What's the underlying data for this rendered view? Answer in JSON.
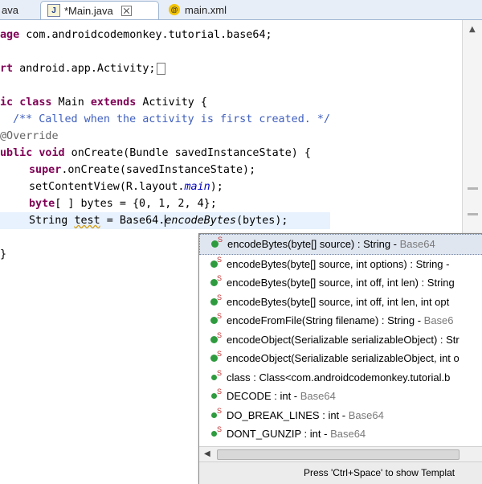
{
  "tabs": [
    {
      "label": "ava",
      "active": false
    },
    {
      "label": "*Main.java",
      "active": true
    },
    {
      "label": "main.xml",
      "active": false
    }
  ],
  "code": {
    "line1": [
      {
        "t": "age com.androidcodemonkey.tutorial.base64;",
        "c": "kw-partial"
      }
    ],
    "l1_kw": "age",
    "l1_rest": " com.androidcodemonkey.tutorial.base64;",
    "l3_kw": "rt",
    "l3_rest": " android.app.Activity;",
    "l5_kw1": "ic",
    "l5_kw2": "class",
    "l5_mid": " Main ",
    "l5_kw3": "extends",
    "l5_rest": " Activity {",
    "l6_comment": "/** Called when the activity is first created. */",
    "l7_anno": "@Override",
    "l8_kw1": "ublic",
    "l8_kw2": "void",
    "l8_rest": " onCreate(Bundle savedInstanceState) {",
    "l9_kw": "super",
    "l9_rest": ".onCreate(savedInstanceState);",
    "l10_pre": "setContentView(R.layout.",
    "l10_field": "main",
    "l10_post": ");",
    "l11_kw": "byte",
    "l11_rest": "[ ] bytes = {0, 1, 2, 4};",
    "l12_pre": "String ",
    "l12_var": "test",
    "l12_mid": " = Base64.",
    "l12_method": "encodeBytes",
    "l12_post": "(bytes);",
    "l14_brace": "}"
  },
  "completions": [
    {
      "main": "encodeBytes(byte[] source) : String - ",
      "gray": "Base64",
      "kind": "method",
      "selected": true
    },
    {
      "main": "encodeBytes(byte[] source, int options) : String - ",
      "gray": "",
      "kind": "method"
    },
    {
      "main": "encodeBytes(byte[] source, int off, int len) : String",
      "gray": "",
      "kind": "method"
    },
    {
      "main": "encodeBytes(byte[] source, int off, int len, int opt",
      "gray": "",
      "kind": "method"
    },
    {
      "main": "encodeFromFile(String filename) : String - ",
      "gray": "Base6",
      "kind": "method"
    },
    {
      "main": "encodeObject(Serializable serializableObject) : Str",
      "gray": "",
      "kind": "method"
    },
    {
      "main": "encodeObject(Serializable serializableObject, int o",
      "gray": "",
      "kind": "method"
    },
    {
      "main": "class : Class<com.androidcodemonkey.tutorial.b",
      "gray": "",
      "kind": "class"
    },
    {
      "main": "DECODE : int - ",
      "gray": "Base64",
      "kind": "field"
    },
    {
      "main": "DO_BREAK_LINES : int - ",
      "gray": "Base64",
      "kind": "field"
    },
    {
      "main": "DONT_GUNZIP : int - ",
      "gray": "Base64",
      "kind": "field"
    }
  ],
  "static_badge": "S",
  "popup_footer": "Press 'Ctrl+Space' to show Templat",
  "icons": {
    "java_file": "J",
    "xml_file": "@",
    "close": "close-icon"
  },
  "colors": {
    "keyword": "#7f0055",
    "comment": "#3f5fbf",
    "annotation": "#646464",
    "field": "#0000c0",
    "current_line": "#e8f2fe",
    "selection": "#dfe6f0",
    "method_icon": "#2e9b3e"
  }
}
